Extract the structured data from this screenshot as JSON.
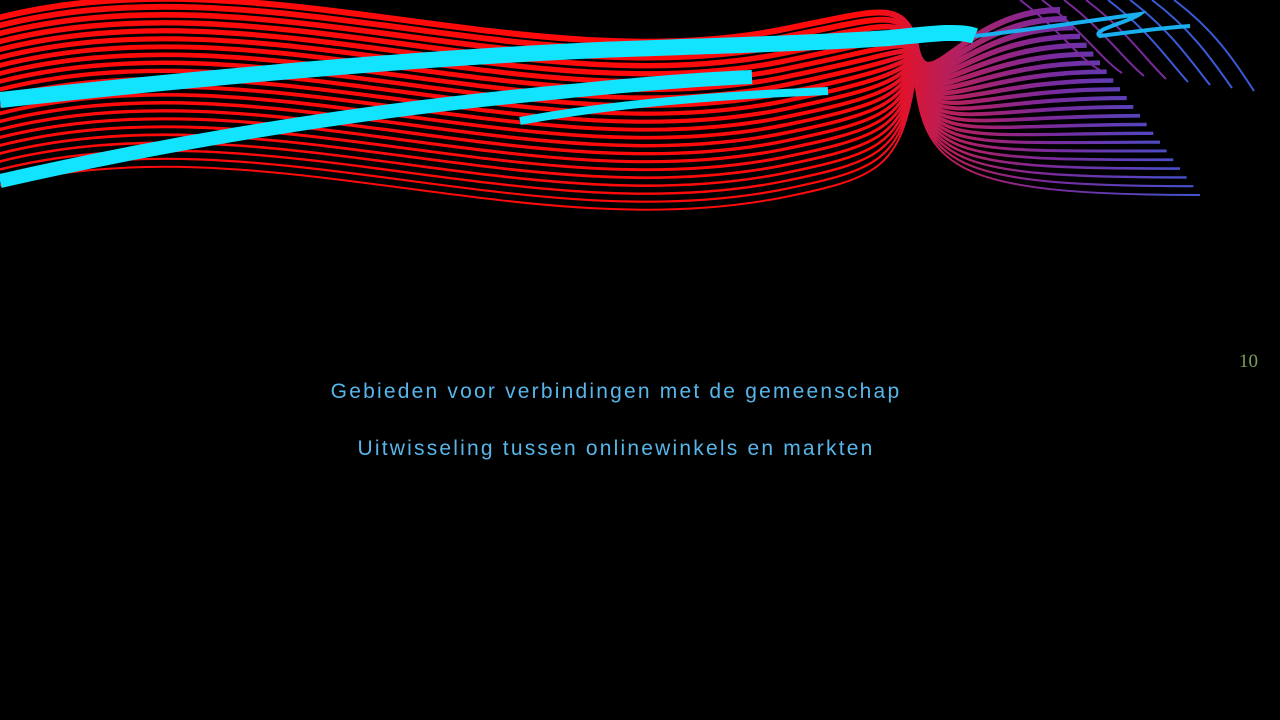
{
  "slide": {
    "number": "10",
    "lines": [
      "Gebieden voor verbindingen met de gemeenschap",
      "Uitwisseling tussen onlinewinkels en markten"
    ]
  },
  "colors": {
    "background": "#000000",
    "text": "#57b6ea",
    "slide_number": "#7ba05b",
    "wave_red": "#ff0a0a",
    "wave_purple": "#7a2a9c",
    "wave_blue": "#3a5ad8",
    "accent_cyan": "#12e4ff"
  }
}
